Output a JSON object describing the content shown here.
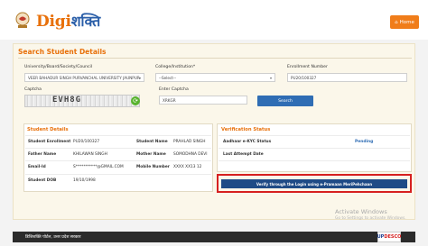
{
  "header": {
    "logo_prefix": "Digi",
    "logo_suffix": "शक्ति",
    "home_label": "Home"
  },
  "search": {
    "title": "Search Student Details",
    "university_label": "University/Board/Society/Council",
    "university_value": "VEER BAHADUR SINGH PURVANCHAL UNIVERSITY JAUNPUR",
    "college_label": "College/Institution*",
    "college_value": "--Select--",
    "enrollment_label": "Enrollment Number",
    "enrollment_value": "PU20/100327",
    "captcha_label": "Captcha",
    "captcha_text": "EVH8G",
    "enter_captcha_label": "Enter Captcha",
    "enter_captcha_value": "XRKGR",
    "search_label": "Search"
  },
  "student": {
    "title": "Student Details",
    "enrollment_label": "Student Enrollment",
    "enrollment_value": "PU20/100327",
    "name_label": "Student Name",
    "name_value": "PRAHLAD SINGH",
    "father_label": "Father Name",
    "father_value": "KHILAWAN SINGH",
    "mother_label": "Mother Name",
    "mother_value": "SOMODHNA DEVI",
    "email_label": "Email-Id",
    "email_value": "S***********@GMAIL.COM",
    "mobile_label": "Mobile Number",
    "mobile_value": "XXXX XX13 12",
    "dob_label": "Student DOB",
    "dob_value": "19/10/1998"
  },
  "verification": {
    "title": "Verification Status",
    "kyc_label": "Aadhaar e-KYC Status",
    "kyc_value": "Pending",
    "last_attempt_label": "Last Attempt Date",
    "verify_button": "Verify through the Login using e-Pramaan MeriPehchaan"
  },
  "watermark": {
    "title": "Activate Windows",
    "subtitle": "Go to Settings to activate Windows."
  },
  "footer": {
    "text": "डिजिशक्ति पोर्टल, उत्तर प्रदेश सरकार",
    "partner_a": "UP",
    "partner_b": "DESCO"
  },
  "colors": {
    "accent": "#e8700a",
    "primary_button": "#2f6db4",
    "verify_button": "#1f4b86",
    "highlight": "#d62020"
  }
}
